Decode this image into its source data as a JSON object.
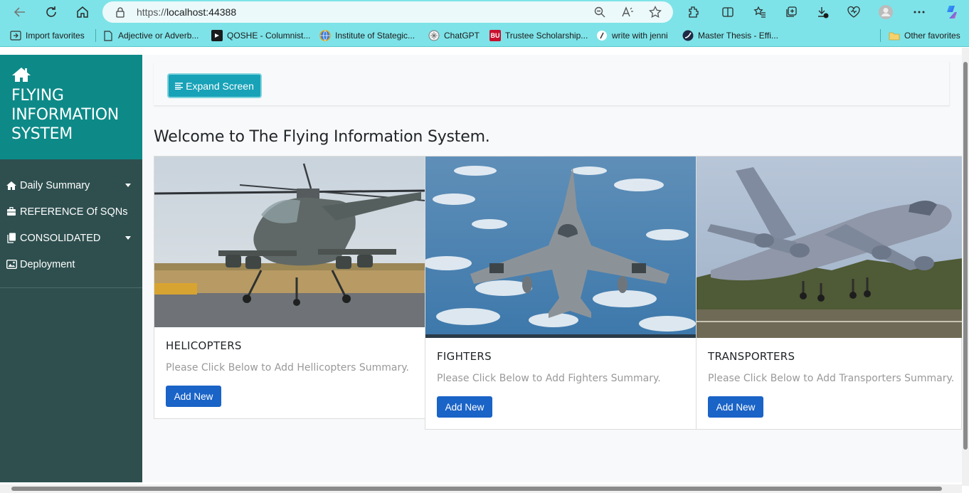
{
  "browser": {
    "url_prefix": "https://",
    "url_host": "localhost:44388",
    "bookmarks": [
      {
        "label": "Import favorites"
      },
      {
        "label": "Adjective or Adverb..."
      },
      {
        "label": "QOSHE - Columnist..."
      },
      {
        "label": "Institute of Stategic..."
      },
      {
        "label": "ChatGPT"
      },
      {
        "label": "Trustee Scholarship..."
      },
      {
        "label": "write with jenni"
      },
      {
        "label": "Master Thesis - Effi..."
      }
    ],
    "other_favorites": "Other favorites",
    "bu_badge": "BU"
  },
  "sidebar": {
    "title": "FLYING INFORMATION SYSTEM",
    "items": [
      {
        "label": "Daily Summary",
        "icon": "home-icon",
        "dropdown": true
      },
      {
        "label": "REFERENCE Of SQNs",
        "icon": "briefcase-icon",
        "dropdown": false
      },
      {
        "label": "CONSOLIDATED",
        "icon": "copy-icon",
        "dropdown": true
      },
      {
        "label": "Deployment",
        "icon": "image-icon",
        "dropdown": false
      }
    ]
  },
  "main": {
    "expand_label": "Expand Screen",
    "welcome": "Welcome to The Flying Information System.",
    "cards": [
      {
        "title": "HELICOPTERS",
        "text": "Please Click Below to Add Hellicopters Summary.",
        "button": "Add New",
        "image": "helicopter-photo"
      },
      {
        "title": "FIGHTERS",
        "text": "Please Click Below to Add Fighters Summary.",
        "button": "Add New",
        "image": "fighter-jet-photo"
      },
      {
        "title": "TRANSPORTERS",
        "text": "Please Click Below to Add Transporters Summary.",
        "button": "Add New",
        "image": "transport-aircraft-photo"
      }
    ]
  },
  "colors": {
    "sidebar_bg": "#2f4f4f",
    "brand_bg": "#0d8a88",
    "expand_btn": "#17a2b8",
    "add_btn": "#1a63c7",
    "chrome_bg": "#7de3e8"
  }
}
